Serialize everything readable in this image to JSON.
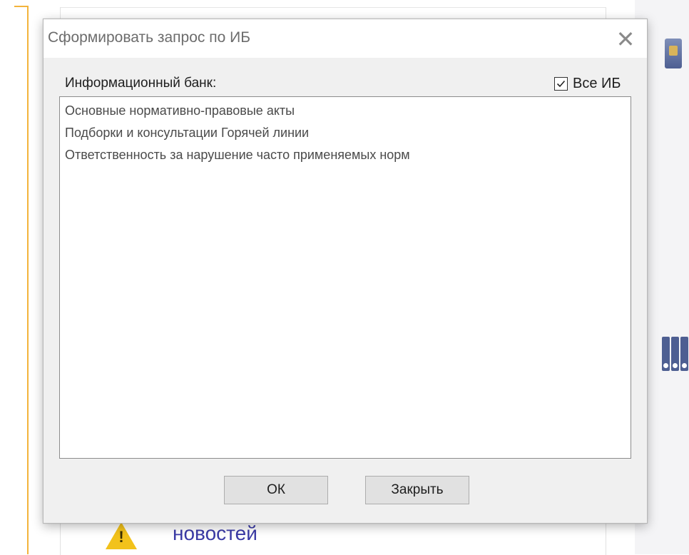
{
  "dialog": {
    "title": "Сформировать запрос по ИБ",
    "ib_label": "Информационный банк:",
    "all_ib_label": "Все ИБ",
    "all_ib_checked": true,
    "items": [
      "Основные нормативно-правовые акты",
      "Подборки и консультации Горячей линии",
      "Ответственность за нарушение часто применяемых норм"
    ],
    "ok_label": "ОК",
    "close_label": "Закрыть"
  },
  "background": {
    "news_text": "новостей"
  },
  "colors": {
    "accent_orange": "#f3b43c",
    "link_blue": "#3a3aa6",
    "warning_yellow": "#f2c21b",
    "dialog_bg": "#f0f0f0"
  }
}
